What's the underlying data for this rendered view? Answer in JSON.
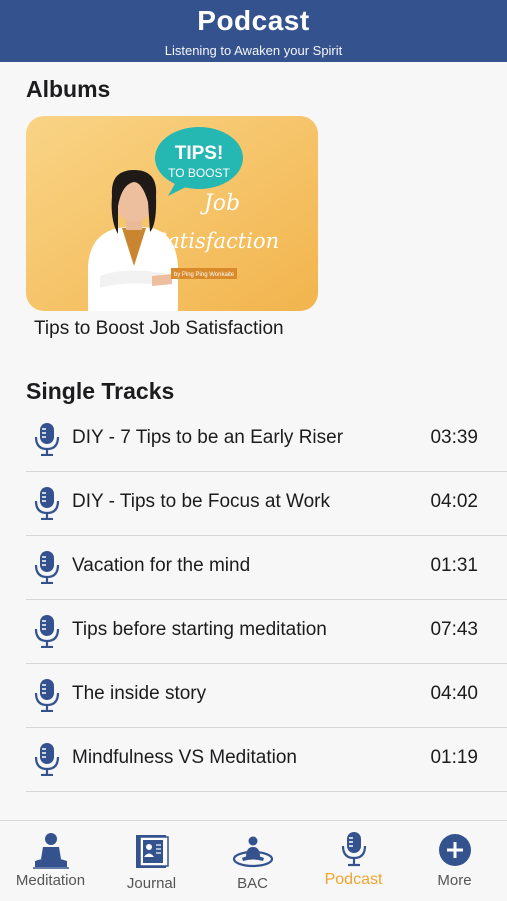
{
  "header": {
    "title": "Podcast",
    "subtitle": "Listening to Awaken your Spirit"
  },
  "albums": {
    "section_title": "Albums",
    "items": [
      {
        "label": "Tips to Boost Job Satisfaction",
        "cover": {
          "bubble_line1": "TIPS!",
          "bubble_line2": "TO BOOST",
          "script_line1": "Job",
          "script_line2": "Satisfaction",
          "byline": "by Ping Ping Wonkaite"
        }
      }
    ]
  },
  "single_tracks": {
    "section_title": "Single Tracks",
    "items": [
      {
        "title": "DIY - 7 Tips to be an Early Riser",
        "duration": "03:39"
      },
      {
        "title": "DIY - Tips to be Focus at Work",
        "duration": "04:02"
      },
      {
        "title": "Vacation for the mind",
        "duration": "01:31"
      },
      {
        "title": "Tips before starting meditation",
        "duration": "07:43"
      },
      {
        "title": "The inside story",
        "duration": "04:40"
      },
      {
        "title": "Mindfulness VS Meditation",
        "duration": "01:19"
      }
    ]
  },
  "tabbar": {
    "items": [
      {
        "label": "Meditation",
        "icon": "meditation-icon"
      },
      {
        "label": "Journal",
        "icon": "journal-icon"
      },
      {
        "label": "BAC",
        "icon": "bac-icon"
      },
      {
        "label": "Podcast",
        "icon": "microphone-icon",
        "active": true
      },
      {
        "label": "More",
        "icon": "plus-circle-icon"
      }
    ]
  },
  "colors": {
    "header_bg": "#34538e",
    "icon_blue": "#34538e",
    "active_tab": "#f0a431",
    "cover_bg": "#f5c46a",
    "bubble": "#25b7b1"
  }
}
